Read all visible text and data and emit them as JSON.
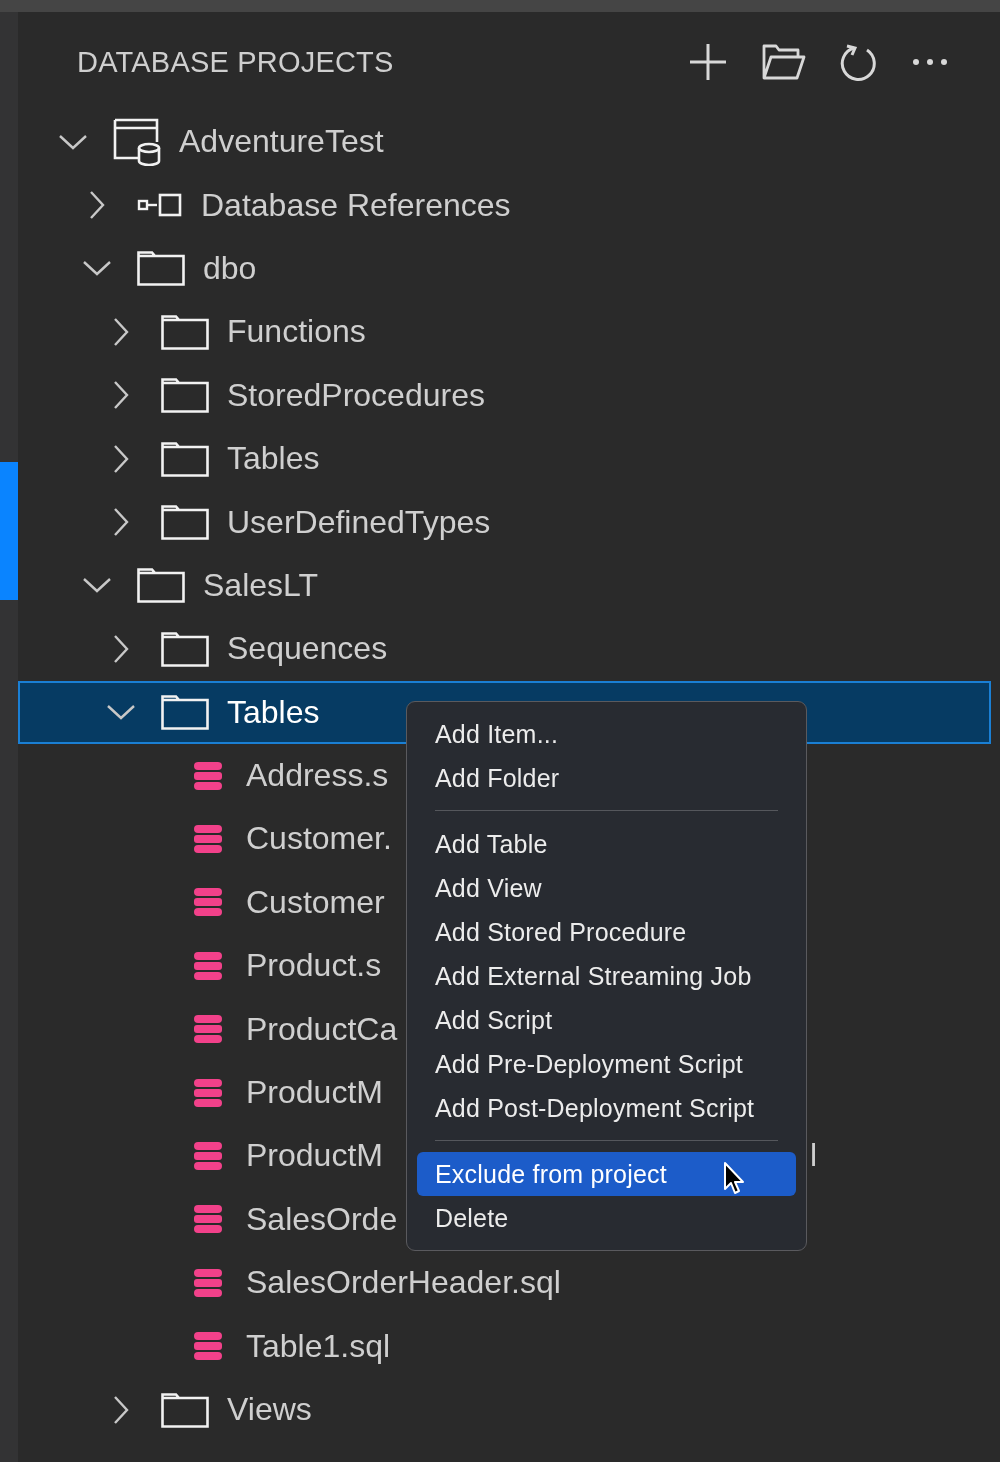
{
  "panel": {
    "title": "DATABASE PROJECTS"
  },
  "tree": [
    {
      "kind": "project",
      "label": "AdventureTest",
      "expanded": true,
      "selected": false,
      "children": [
        {
          "kind": "references",
          "label": "Database References",
          "expanded": false,
          "selected": false
        },
        {
          "kind": "folder",
          "label": "dbo",
          "expanded": true,
          "selected": false,
          "children": [
            {
              "kind": "folder",
              "label": "Functions",
              "expanded": false,
              "selected": false
            },
            {
              "kind": "folder",
              "label": "StoredProcedures",
              "expanded": false,
              "selected": false
            },
            {
              "kind": "folder",
              "label": "Tables",
              "expanded": false,
              "selected": false
            },
            {
              "kind": "folder",
              "label": "UserDefinedTypes",
              "expanded": false,
              "selected": false
            }
          ]
        },
        {
          "kind": "folder",
          "label": "SalesLT",
          "expanded": true,
          "selected": false,
          "children": [
            {
              "kind": "folder",
              "label": "Sequences",
              "expanded": false,
              "selected": false
            },
            {
              "kind": "folder",
              "label": "Tables",
              "expanded": true,
              "selected": true,
              "children": [
                {
                  "kind": "file",
                  "label": "Address.s",
                  "selected": false
                },
                {
                  "kind": "file",
                  "label": "Customer.",
                  "selected": false
                },
                {
                  "kind": "file",
                  "label": "Customer",
                  "selected": false
                },
                {
                  "kind": "file",
                  "label": "Product.s",
                  "selected": false
                },
                {
                  "kind": "file",
                  "label": "ProductCa",
                  "selected": false
                },
                {
                  "kind": "file",
                  "label": "ProductM",
                  "selected": false
                },
                {
                  "kind": "file",
                  "label": "ProductM",
                  "trailing_text": "l",
                  "selected": false
                },
                {
                  "kind": "file",
                  "label": "SalesOrde",
                  "selected": false
                },
                {
                  "kind": "file",
                  "label": "SalesOrderHeader.sql",
                  "selected": false
                },
                {
                  "kind": "file",
                  "label": "Table1.sql",
                  "selected": false
                }
              ]
            },
            {
              "kind": "folder",
              "label": "Views",
              "expanded": false,
              "selected": false
            }
          ]
        }
      ]
    }
  ],
  "context_menu": {
    "items": [
      {
        "kind": "item",
        "label": "Add Item...",
        "selected": false
      },
      {
        "kind": "item",
        "label": "Add Folder",
        "selected": false
      },
      {
        "kind": "separator"
      },
      {
        "kind": "item",
        "label": "Add Table",
        "selected": false
      },
      {
        "kind": "item",
        "label": "Add View",
        "selected": false
      },
      {
        "kind": "item",
        "label": "Add Stored Procedure",
        "selected": false
      },
      {
        "kind": "item",
        "label": "Add External Streaming Job",
        "selected": false
      },
      {
        "kind": "item",
        "label": "Add Script",
        "selected": false
      },
      {
        "kind": "item",
        "label": "Add Pre-Deployment Script",
        "selected": false
      },
      {
        "kind": "item",
        "label": "Add Post-Deployment Script",
        "selected": false
      },
      {
        "kind": "separator"
      },
      {
        "kind": "item",
        "label": "Exclude from project",
        "selected": true
      },
      {
        "kind": "item",
        "label": "Delete",
        "selected": false
      }
    ]
  }
}
